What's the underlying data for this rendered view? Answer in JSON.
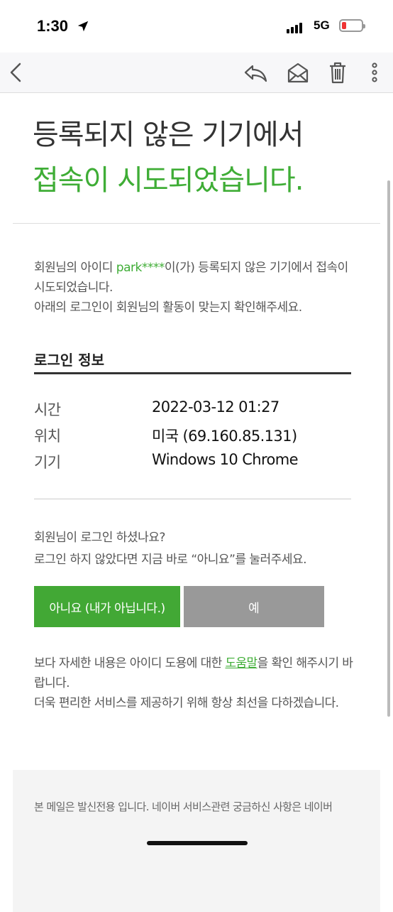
{
  "status_bar": {
    "time": "1:30",
    "network": "5G"
  },
  "headline": {
    "line1": "등록되지 않은 기기에서",
    "line2": "접속이 시도되었습니다."
  },
  "intro": {
    "part1": "회원님의 아이디 ",
    "user_id": "park****",
    "part2": "이(가) 등록되지 않은 기기에서 접속이 시도되었습니다.",
    "line2": "아래의 로그인이 회원님의 활동이 맞는지 확인해주세요."
  },
  "login_info": {
    "title": "로그인 정보",
    "rows": [
      {
        "label": "시간",
        "value": "2022-03-12 01:27"
      },
      {
        "label": "위치",
        "value": "미국 (69.160.85.131)"
      },
      {
        "label": "기기",
        "value": "Windows 10 Chrome"
      }
    ]
  },
  "question": {
    "line1": "회원님이 로그인 하셨나요?",
    "line2": "로그인 하지 않았다면 지금 바로 “아니요”를 눌러주세요."
  },
  "buttons": {
    "no_label": "아니요 (내가 아닙니다.)",
    "yes_label": "예"
  },
  "detail": {
    "part1": "보다 자세한 내용은 아이디 도용에 대한 ",
    "help_link": "도움말",
    "part2": "을 확인 해주시기 바랍니다.",
    "line2": "더욱 편리한 서비스를 제공하기 위해 항상 최선을 다하겠습니다."
  },
  "footer": {
    "text": "본 메일은 발신전용 입니다. 네이버 서비스관련 궁금하신 사항은 네이버"
  },
  "icons": {
    "back": "chevron-left-icon",
    "reply": "reply-icon",
    "mail": "open-envelope-icon",
    "delete": "trash-icon",
    "more": "more-vertical-icon"
  },
  "colors": {
    "accent_green": "#3fad36",
    "button_green": "#42a835",
    "button_gray": "#999999"
  }
}
